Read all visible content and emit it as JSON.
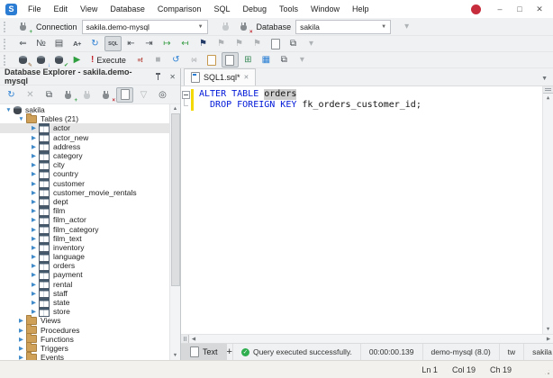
{
  "titlebar": {
    "logo_letter": "S",
    "menu": [
      "File",
      "Edit",
      "View",
      "Database",
      "Comparison",
      "SQL",
      "Debug",
      "Tools",
      "Window",
      "Help"
    ],
    "window_buttons": [
      {
        "name": "minimize-button",
        "glyph": "–"
      },
      {
        "name": "maximize-button",
        "glyph": "□"
      },
      {
        "name": "close-button",
        "glyph": "✕"
      }
    ]
  },
  "connection_bar": {
    "connection_label": "Connection",
    "connection_value": "sakila.demo-mysql",
    "database_label": "Database",
    "database_value": "sakila",
    "new_connection_icon": {
      "name": "new-connection-icon",
      "kind": "plug",
      "badge": "+",
      "badge_color": "#2e9e3e"
    },
    "connect_icon": {
      "name": "connect-icon",
      "kind": "plug",
      "state": "disabled"
    },
    "disconnect_icon": {
      "name": "disconnect-icon",
      "kind": "plug",
      "badge": "×",
      "badge_color": "#c2242e"
    },
    "overflow_icon": {
      "name": "connection-overflow-icon",
      "glyph": "▾",
      "state": "disabled"
    }
  },
  "edit_toolbar": {
    "icons": [
      {
        "name": "go-to-icon",
        "glyph": "⇐"
      },
      {
        "name": "line-numbers-icon",
        "glyph": "№"
      },
      {
        "name": "document-outline-icon",
        "glyph": "▤"
      },
      {
        "name": "font-increase-icon",
        "glyph": "A+"
      },
      {
        "name": "refresh-code-completion-icon",
        "glyph": "↻",
        "color": "#2a7fd4"
      },
      {
        "name": "format-sql-icon",
        "glyph": "SQL",
        "state": "active"
      },
      {
        "name": "decrease-indent-icon",
        "glyph": "⇤"
      },
      {
        "name": "increase-indent-icon",
        "glyph": "⇥"
      },
      {
        "name": "comment-icon",
        "glyph": "↦",
        "color": "#3a9e46"
      },
      {
        "name": "uncomment-icon",
        "glyph": "↤",
        "color": "#3a9e46"
      },
      {
        "name": "bookmark-icon",
        "glyph": "⚑",
        "color": "#223a66"
      },
      {
        "name": "previous-bookmark-icon",
        "glyph": "⚑",
        "state": "disabled"
      },
      {
        "name": "next-bookmark-icon",
        "glyph": "⚑",
        "state": "disabled"
      },
      {
        "name": "clear-bookmarks-icon",
        "glyph": "⚑",
        "state": "disabled"
      },
      {
        "name": "new-document-icon",
        "kind": "page"
      },
      {
        "name": "window-cascade-icon",
        "glyph": "⧉"
      },
      {
        "name": "edit-overflow-icon",
        "glyph": "▾",
        "state": "disabled"
      }
    ]
  },
  "execute_toolbar": {
    "icons": [
      {
        "name": "new-sql-database-icon",
        "kind": "db",
        "badge": "✎",
        "badge_color": "#8a5a2a"
      },
      {
        "name": "refresh-database-icon",
        "kind": "db",
        "badge": "↓",
        "badge_color": "#2a7fd4"
      },
      {
        "name": "commit-database-icon",
        "kind": "db",
        "badge": "✔",
        "badge_color": "#2e9e3e"
      },
      {
        "name": "run-icon",
        "glyph": "▶",
        "color": "#2e9e3e"
      },
      {
        "name": "execute-button",
        "kind": "execute",
        "glyph": "!",
        "label": "Execute",
        "color": "#c2242e"
      },
      {
        "name": "execute-script-icon",
        "glyph": "≡!",
        "color": "#b4372e"
      },
      {
        "name": "stop-icon",
        "glyph": "■",
        "state": "disabled"
      },
      {
        "name": "query-history-icon",
        "glyph": "↺",
        "color": "#2a7fd4"
      },
      {
        "name": "parameters-icon",
        "glyph": "(a)",
        "state": "disabled"
      },
      {
        "name": "open-file-icon",
        "kind": "page",
        "color": "#c59a4e"
      },
      {
        "name": "save-snippet-icon",
        "kind": "page",
        "state": "active"
      },
      {
        "name": "query-profiler-icon",
        "glyph": "⊞",
        "color": "#3b8a5a"
      },
      {
        "name": "diagram-icon",
        "glyph": "▦",
        "color": "#2a7fd4"
      },
      {
        "name": "new-window-icon",
        "glyph": "⧉"
      },
      {
        "name": "execute-overflow-icon",
        "glyph": "▾",
        "state": "disabled"
      }
    ]
  },
  "explorer": {
    "title": "Database Explorer - sakila.demo-mysql",
    "toolbar_icons": [
      {
        "name": "refresh-icon",
        "glyph": "↻",
        "color": "#2a7fd4"
      },
      {
        "name": "delete-icon",
        "glyph": "✕",
        "state": "disabled"
      },
      {
        "name": "object-viewer-icon",
        "glyph": "⧉"
      },
      {
        "name": "new-connection-icon",
        "kind": "plug",
        "badge": "+",
        "badge_color": "#2e9e3e"
      },
      {
        "name": "connect-icon",
        "kind": "plug",
        "state": "disabled"
      },
      {
        "name": "disconnect-icon",
        "kind": "plug",
        "badge": "×",
        "badge_color": "#c2242e"
      },
      {
        "name": "duplicate-object-icon",
        "kind": "page",
        "state": "active"
      },
      {
        "name": "filter-icon",
        "glyph": "▽",
        "state": "disabled"
      },
      {
        "name": "explorer-options-icon",
        "glyph": "◎"
      }
    ],
    "tree": [
      {
        "label": "sakila",
        "icon": "db",
        "level": 0,
        "arrow": "expanded"
      },
      {
        "label": "Tables (21)",
        "icon": "folder",
        "level": 1,
        "arrow": "expanded"
      },
      {
        "label": "actor",
        "icon": "table",
        "level": 2,
        "arrow": "collapsed",
        "selected": true
      },
      {
        "label": "actor_new",
        "icon": "table",
        "level": 2,
        "arrow": "collapsed"
      },
      {
        "label": "address",
        "icon": "table",
        "level": 2,
        "arrow": "collapsed"
      },
      {
        "label": "category",
        "icon": "table",
        "level": 2,
        "arrow": "collapsed"
      },
      {
        "label": "city",
        "icon": "table",
        "level": 2,
        "arrow": "collapsed"
      },
      {
        "label": "country",
        "icon": "table",
        "level": 2,
        "arrow": "collapsed"
      },
      {
        "label": "customer",
        "icon": "table",
        "level": 2,
        "arrow": "collapsed"
      },
      {
        "label": "customer_movie_rentals",
        "icon": "table",
        "level": 2,
        "arrow": "collapsed"
      },
      {
        "label": "dept",
        "icon": "table",
        "level": 2,
        "arrow": "collapsed"
      },
      {
        "label": "film",
        "icon": "table",
        "level": 2,
        "arrow": "collapsed"
      },
      {
        "label": "film_actor",
        "icon": "table",
        "level": 2,
        "arrow": "collapsed"
      },
      {
        "label": "film_category",
        "icon": "table",
        "level": 2,
        "arrow": "collapsed"
      },
      {
        "label": "film_text",
        "icon": "table",
        "level": 2,
        "arrow": "collapsed"
      },
      {
        "label": "inventory",
        "icon": "table",
        "level": 2,
        "arrow": "collapsed"
      },
      {
        "label": "language",
        "icon": "table",
        "level": 2,
        "arrow": "collapsed"
      },
      {
        "label": "orders",
        "icon": "table",
        "level": 2,
        "arrow": "collapsed"
      },
      {
        "label": "payment",
        "icon": "table",
        "level": 2,
        "arrow": "collapsed"
      },
      {
        "label": "rental",
        "icon": "table",
        "level": 2,
        "arrow": "collapsed"
      },
      {
        "label": "staff",
        "icon": "table",
        "level": 2,
        "arrow": "collapsed"
      },
      {
        "label": "state",
        "icon": "table",
        "level": 2,
        "arrow": "collapsed"
      },
      {
        "label": "store",
        "icon": "table",
        "level": 2,
        "arrow": "collapsed"
      },
      {
        "label": "Views",
        "icon": "folder",
        "level": 1,
        "arrow": "collapsed"
      },
      {
        "label": "Procedures",
        "icon": "folder",
        "level": 1,
        "arrow": "collapsed"
      },
      {
        "label": "Functions",
        "icon": "folder",
        "level": 1,
        "arrow": "collapsed"
      },
      {
        "label": "Triggers",
        "icon": "folder",
        "level": 1,
        "arrow": "collapsed"
      },
      {
        "label": "Events",
        "icon": "folder",
        "level": 1,
        "arrow": "collapsed"
      }
    ]
  },
  "editor": {
    "tab_title": "SQL1.sql*",
    "code": {
      "line1": {
        "keyword": "ALTER TABLE ",
        "highlighted": "orders"
      },
      "line2": {
        "keyword": "  DROP FOREIGN KEY ",
        "identifier": "fk_orders_customer_id;"
      }
    }
  },
  "results_bar": {
    "tab_label": "Text",
    "new_tab_label": "+",
    "status_message": "Query executed successfully.",
    "status_check_glyph": "✓",
    "duration": "00:00:00.139",
    "server": "demo-mysql (8.0)",
    "user": "tw",
    "database": "sakila"
  },
  "status_bar": {
    "line": "Ln 1",
    "column": "Col 19",
    "chars": "Ch 19"
  },
  "colors": {
    "accent_blue": "#2a7fd4",
    "keyword_blue": "#0018d8",
    "word_highlight_bg": "#cdcdcd",
    "success_green": "#2eae4e",
    "error_red": "#c2242e",
    "folder_tan": "#cfa158",
    "change_bar_yellow": "#f4d802"
  }
}
